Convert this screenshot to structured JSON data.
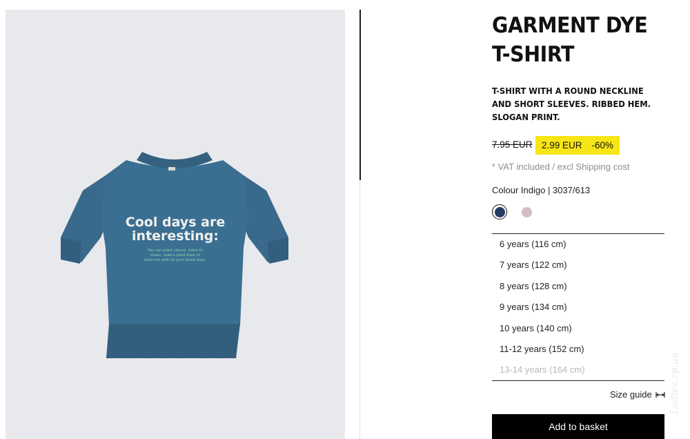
{
  "product": {
    "title": "GARMENT DYE T-SHIRT",
    "description": "T-SHIRT WITH A ROUND NECKLINE AND SHORT SLEEVES. RIBBED HEM. SLOGAN PRINT.",
    "price_old": "7.95 EUR",
    "price_new": "2.99 EUR",
    "discount": "-60%",
    "vat_note": "* VAT included / excl Shipping cost",
    "colour_label": "Colour Indigo | 3037/613",
    "swatches": [
      {
        "name": "indigo",
        "color": "#243b63",
        "selected": true
      },
      {
        "name": "pink",
        "color": "#d3bcc6",
        "selected": false
      }
    ]
  },
  "image": {
    "print_line1": "Cool days are",
    "print_line2": "interesting:",
    "print_small1": "You can paint, dance, listen to",
    "print_small2": "music, read a good book or",
    "print_small3": "have fun with all your loved ones.",
    "shirt_color": "#3a6f93",
    "background_color": "#e8e9ec"
  },
  "sizes": [
    {
      "label": "6 years (116 cm)",
      "available": true
    },
    {
      "label": "7 years (122 cm)",
      "available": true
    },
    {
      "label": "8 years (128 cm)",
      "available": true
    },
    {
      "label": "9 years (134 cm)",
      "available": true
    },
    {
      "label": "10 years (140 cm)",
      "available": true
    },
    {
      "label": "11-12 years (152 cm)",
      "available": true
    },
    {
      "label": "13-14 years (164 cm)",
      "available": false
    }
  ],
  "actions": {
    "size_guide": "Size guide",
    "add_to_basket": "Add to basket"
  },
  "watermark": "Ladies.zp.ua",
  "colors": {
    "highlight": "#f7e516",
    "button": "#000000"
  }
}
